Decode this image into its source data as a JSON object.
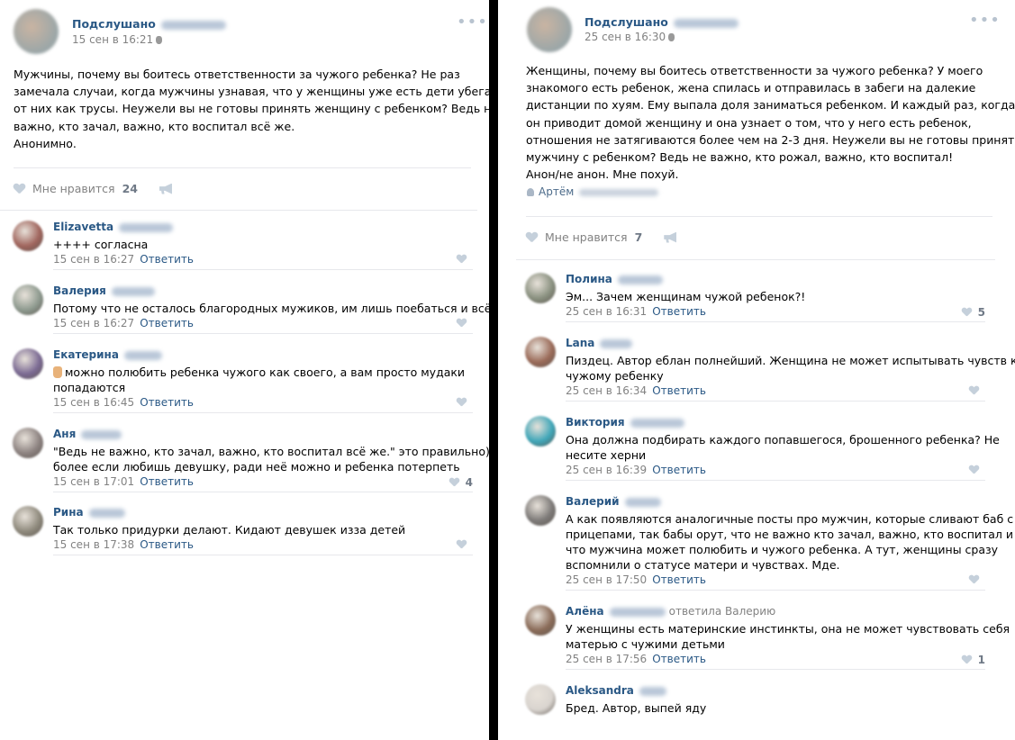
{
  "left_post": {
    "author": "Подслушано",
    "date": "15 сен в 16:21",
    "text_lines": [
      "Мужчины, почему вы боитесь ответственности за чужого ребенка? Не раз",
      "замечала случаи, когда мужчины узнавая, что у женщины уже есть дети убегали",
      "от них как трусы. Неужели вы не готовы принять женщину с ребенком? Ведь не",
      "важно, кто зачал, важно, кто воспитал всё же.",
      "Анонимно."
    ],
    "like_label": "Мне нравится",
    "like_count": "24",
    "comments": [
      {
        "name": "Elizavetta",
        "lines": [
          "++++ согласна"
        ],
        "date": "15 сен в 16:27",
        "reply": "Ответить",
        "likes": "",
        "avatar_color": "#a0655d"
      },
      {
        "name": "Валерия",
        "lines": [
          "Потому что не осталось благородных мужиков, им лишь поебаться и всё"
        ],
        "date": "15 сен в 16:27",
        "reply": "Ответить",
        "likes": "",
        "avatar_color": "#8e9a8f"
      },
      {
        "name": "Екатерина",
        "lines": [
          "можно полюбить ребенка чужого как своего, а вам просто мудаки",
          "попадаются"
        ],
        "date": "15 сен в 16:45",
        "reply": "Ответить",
        "likes": "",
        "avatar_color": "#7b6a93"
      },
      {
        "name": "Аня",
        "lines": [
          "\"Ведь не важно, кто зачал, важно, кто воспитал всё же.\" это правильно) Тем",
          "более если любишь девушку, ради неё можно и ребенка потерпеть"
        ],
        "date": "15 сен в 17:01",
        "reply": "Ответить",
        "likes": "4",
        "avatar_color": "#8d8381"
      },
      {
        "name": "Рина",
        "lines": [
          "Так только придурки делают. Кидают девушек изза детей"
        ],
        "date": "15 сен в 17:38",
        "reply": "Ответить",
        "likes": "",
        "avatar_color": "#8f8a7d"
      }
    ]
  },
  "right_post": {
    "author": "Подслушано",
    "date": "25 сен в 16:30",
    "text_lines": [
      "Женщины, почему вы боитесь ответственности за чужого ребенка? У моего",
      "знакомого есть ребенок, жена спилась и отправилась в забеги на далекие",
      "дистанции по хуям. Ему выпала доля заниматься ребенком. И каждый раз, когда",
      "он приводит домой женщину и она узнает о том, что у него есть ребенок,",
      "отношения не затягиваются более чем на 2-3 дня. Неужели вы не готовы принять",
      "мужчину с ребенком? Ведь не важно, кто рожал, важно, кто воспитал!",
      "Анон/не анон. Мне похуй."
    ],
    "signer": "Артём",
    "like_label": "Мне нравится",
    "like_count": "7",
    "comments": [
      {
        "name": "Полина",
        "reply_to": "",
        "lines": [
          "Эм... Зачем женщинам чужой ребенок?!"
        ],
        "date": "25 сен в 16:31",
        "reply": "Ответить",
        "likes": "5",
        "avatar_color": "#8a9180"
      },
      {
        "name": "Lana",
        "reply_to": "",
        "lines": [
          "Пиздец. Автор еблан полнейший. Женщина не может испытывать чувств к",
          "чужому ребенку"
        ],
        "date": "25 сен в 16:34",
        "reply": "Ответить",
        "likes": "",
        "avatar_color": "#9a6a58"
      },
      {
        "name": "Виктория",
        "reply_to": "",
        "lines": [
          "Она должна подбирать каждого попавшегося, брошенного ребенка? Не",
          "несите херни"
        ],
        "date": "25 сен в 16:39",
        "reply": "Ответить",
        "likes": "",
        "avatar_color": "#3fa6b8"
      },
      {
        "name": "Валерий",
        "reply_to": "",
        "lines": [
          "А как появляются аналогичные посты про мужчин, которые сливают баб с",
          "прицепами, так бабы орут, что не важно кто зачал, важно, кто воспитал и",
          "что мужчина может полюбить и чужого ребенка. А тут, женщины сразу",
          "вспомнили о статусе матери и чувствах. Мде."
        ],
        "date": "25 сен в 17:50",
        "reply": "Ответить",
        "likes": "",
        "avatar_color": "#7d7a78"
      },
      {
        "name": "Алёна",
        "reply_to": "ответила Валерию",
        "lines": [
          "У женщины есть материнские инстинкты, она не может чувствовать себя",
          "матерью с чужими детьми"
        ],
        "date": "25 сен в 17:56",
        "reply": "Ответить",
        "likes": "1",
        "avatar_color": "#8a6b58"
      },
      {
        "name": "Aleksandra",
        "reply_to": "",
        "lines": [
          "Бред. Автор, выпей яду"
        ],
        "date": "",
        "reply": "",
        "likes": "",
        "avatar_color": "#d9d4cf"
      }
    ]
  }
}
